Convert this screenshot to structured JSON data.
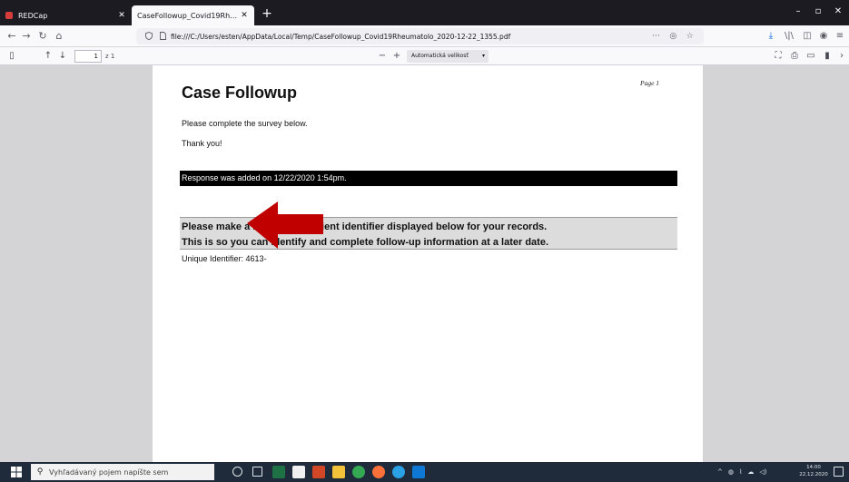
{
  "browser": {
    "tabs": [
      {
        "label": "REDCap",
        "active": false
      },
      {
        "label": "CaseFollowup_Covid19Rheumatolo_",
        "active": true
      }
    ],
    "new_tab_label": "+",
    "tab_close_glyph": "✕",
    "window_controls": {
      "minimize": "–",
      "maximize": "▫",
      "close": "✕"
    },
    "nav": {
      "back": "←",
      "forward": "→",
      "reload": "↻",
      "home": "⌂"
    },
    "url": "file:///C:/Users/esten/AppData/Local/Temp/CaseFollowup_Covid19Rheumatolo_2020-12-22_1355.pdf",
    "url_actions": {
      "more": "···",
      "pocket": "◎",
      "bookmark": "☆"
    },
    "right_icons": {
      "downloads": "⤓",
      "library": "\\|\\",
      "sidebar": "◫",
      "account": "◉",
      "menu": "≡"
    }
  },
  "pdf_toolbar": {
    "sidebar_toggle": "▯",
    "prev_page": "↑",
    "next_page": "↓",
    "page_number": "1",
    "page_total": "z 1",
    "zoom_out": "−",
    "zoom_in": "+",
    "zoom_value": "Automatická velikosť",
    "zoom_caret": "▾",
    "presentation": "⛶",
    "print": "⎙",
    "open_file": "▭",
    "bookmark": "▮",
    "more_tools": "›"
  },
  "document": {
    "page_label": "Page 1",
    "title": "Case Followup",
    "intro": "Please complete the survey below.",
    "thanks": "Thank you!",
    "response_added": "Response was added on 12/22/2020 1:54pm.",
    "notice_line1": "Please make a note of the patient identifier displayed below for your records.",
    "notice_line2": "This is so you can identify and complete follow-up information at a later date.",
    "unique_identifier": "Unique Identifier: 4613-"
  },
  "annotation": {
    "arrow_color": "#c00000"
  },
  "taskbar": {
    "search_glyph": "⚲",
    "search_placeholder": "Vyhľadávaný pojem napíšte sem",
    "apps": [
      {
        "name": "cortana",
        "color": "#dfe6ee"
      },
      {
        "name": "task-view",
        "color": "#dfe6ee"
      },
      {
        "name": "excel",
        "color": "#1e7145"
      },
      {
        "name": "store",
        "color": "#f0f0f0"
      },
      {
        "name": "powerpoint",
        "color": "#d24726"
      },
      {
        "name": "file-explorer",
        "color": "#f3c13a"
      },
      {
        "name": "chrome",
        "color": "#34a853"
      },
      {
        "name": "firefox",
        "color": "#ff7139"
      },
      {
        "name": "edge",
        "color": "#2aa0e5"
      },
      {
        "name": "outlook",
        "color": "#0f78d4"
      }
    ],
    "tray": {
      "chevron": "^",
      "network": "◍",
      "wifi": "⌇",
      "cloud": "☁",
      "volume": "◁)"
    },
    "clock_time": "14:00",
    "clock_date": "22.12.2020"
  }
}
